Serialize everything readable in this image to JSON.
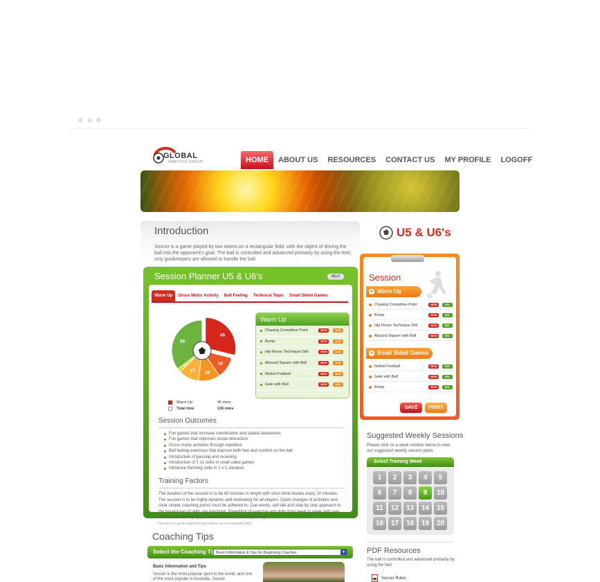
{
  "brand": {
    "name": "GLOBAL",
    "tagline": "AMBITION GROUP"
  },
  "nav": [
    "HOME",
    "ABOUT US",
    "RESOURCES",
    "CONTACT US",
    "MY PROFILE",
    "LOGOFF"
  ],
  "intro": {
    "title": "Introduction",
    "text": "Soccer is a game played by two teams on a rectangular field, with the object of driving the ball into the opponent's goal. The ball is controlled and advanced primarily by using the feet; only goalkeepers are allowed to handle the ball."
  },
  "planner": {
    "title": "Session Planner U5 & U6's",
    "help": "HELP",
    "tabs": [
      "Warm Up",
      "Gross Motor Activity",
      "Ball Feeling",
      "Technical Topic",
      "Small Sided Games"
    ],
    "chart_data": {
      "type": "pie",
      "slices": [
        {
          "label": "Warm Up",
          "value": 45,
          "color": "#d7261c"
        },
        {
          "value": 18,
          "color": "#f15a24"
        },
        {
          "value": 18,
          "color": "#f7941d"
        },
        {
          "value": 17,
          "color": "#fbb03b"
        },
        {
          "value": 3,
          "color": "#d7df23"
        },
        {
          "value": 55,
          "color": "#6cb33f"
        }
      ]
    },
    "legend": [
      {
        "label": "Warm Up",
        "value": "45 mins",
        "color": "#d7261c"
      },
      {
        "label": "Total time",
        "value": "136 mins",
        "color": "#999999"
      }
    ],
    "warmup": {
      "title": "Warm Up",
      "items": [
        "Chasing Comptitive Point",
        "Bump",
        "Hip Flexor Technique Drill",
        "Abound Square with Ball",
        "Netbal Football",
        "Gate with Ball"
      ],
      "view": "VIEW",
      "add": "ADD"
    },
    "outcomes_title": "Session Outcomes",
    "outcomes": [
      "Fun games that increase coordination and spatial awareness",
      "Fun games that improves social interaction",
      "Gross motor activities through repetition",
      "Ball feeling exercises that improve both feet and comfort on the ball",
      "Introduction of passing and receiving",
      "Introduction of 1 v1 skills in small sided games",
      "Introduce finishing skills in 1 v 1 situation."
    ],
    "factors_title": "Training Factors",
    "factors_text": "The duration of the session is to be 60 minutes in lenght with short drink breaks every 10 minutes. The session is to be highly dynamic and motivating for all players. Quick changes of activities and clear simple coaching points must be adhered to. Cue words, self talk and step by step approach to the breakdown of skills are important. Repetition of exercise and drills from week to week with new skills added once players have demonstrated competency."
  },
  "footnote": "* Soccer is a game played by two teams on a rectangular field.",
  "coaching": {
    "title": "Coaching Tips",
    "label": "Select the Coaching Tip:",
    "selected": "Basic Information & Tips for Beginning Coaches",
    "basic_title": "Basic Information and Tips",
    "basic_text": "Soccer is the most popular sport in the world, and one of the most popular in Australia. Soccer"
  },
  "side": {
    "age_title": "U5 & U6's",
    "session_title": "Session",
    "warmup_head": "Warm Up",
    "warmup_items": [
      "Chasing Comptitive Point",
      "Bump",
      "Hip Flexor Technique Drill",
      "Abound Square with Ball"
    ],
    "ssg_head": "Small Sided Games",
    "ssg_items": [
      "Netbal Football",
      "Gate with Ball",
      "Bump"
    ],
    "view": "VIEW",
    "del": "DEL",
    "save": "SAVE",
    "print": "PRINT"
  },
  "weekly": {
    "title": "Suggested Weekly Sessions",
    "text": "Please click on a week number below to view our suggested weekly session plans",
    "head": "Select Training Week",
    "weeks": [
      1,
      2,
      3,
      4,
      5,
      6,
      7,
      8,
      9,
      10,
      11,
      12,
      13,
      14,
      15,
      16,
      17,
      18,
      19,
      20
    ],
    "selected": 9
  },
  "pdf": {
    "title": "PDF Resources",
    "text": "The ball is controlled and advanced primarily by using the feet.",
    "link": "Soccer Rules"
  }
}
